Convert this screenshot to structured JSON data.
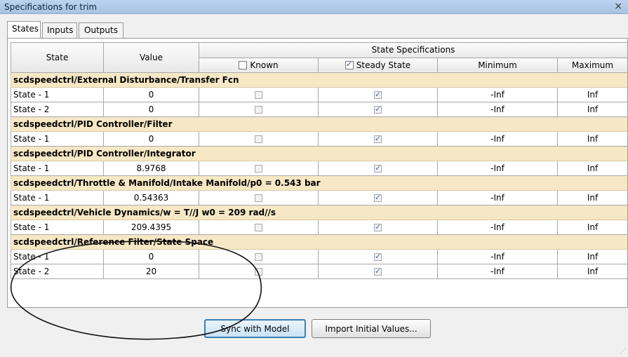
{
  "window": {
    "title": "Specifications for trim",
    "close_label": "×"
  },
  "tabs": [
    {
      "label": "States",
      "active": true
    },
    {
      "label": "Inputs",
      "active": false
    },
    {
      "label": "Outputs",
      "active": false
    }
  ],
  "table": {
    "col_state": "State",
    "col_value": "Value",
    "col_specs": "State Specifications",
    "col_known": "Known",
    "col_steady": "Steady State",
    "col_min": "Minimum",
    "col_max": "Maximum",
    "header_known_checked": false,
    "header_steady_checked": true
  },
  "groups": [
    {
      "name": "scdspeedctrl/External Disturbance/Transfer Fcn",
      "rows": [
        {
          "state": "State - 1",
          "value": "0",
          "known": false,
          "steady": true,
          "min": "-Inf",
          "max": "Inf"
        },
        {
          "state": "State - 2",
          "value": "0",
          "known": false,
          "steady": true,
          "min": "-Inf",
          "max": "Inf"
        }
      ]
    },
    {
      "name": "scdspeedctrl/PID Controller/Filter",
      "rows": [
        {
          "state": "State - 1",
          "value": "0",
          "known": false,
          "steady": true,
          "min": "-Inf",
          "max": "Inf"
        }
      ]
    },
    {
      "name": "scdspeedctrl/PID Controller/Integrator",
      "rows": [
        {
          "state": "State - 1",
          "value": "8.9768",
          "known": false,
          "steady": true,
          "min": "-Inf",
          "max": "Inf"
        }
      ]
    },
    {
      "name": "scdspeedctrl/Throttle & Manifold/Intake Manifold/p0 = 0.543 bar",
      "rows": [
        {
          "state": "State - 1",
          "value": "0.54363",
          "known": false,
          "steady": true,
          "min": "-Inf",
          "max": "Inf"
        }
      ]
    },
    {
      "name": "scdspeedctrl/Vehicle Dynamics/w = T//J w0 = 209 rad//s",
      "rows": [
        {
          "state": "State - 1",
          "value": "209.4395",
          "known": false,
          "steady": true,
          "min": "-Inf",
          "max": "Inf"
        }
      ]
    },
    {
      "name": "scdspeedctrl/Reference Filter/State Space",
      "rows": [
        {
          "state": "State - 1",
          "value": "0",
          "known": false,
          "steady": true,
          "min": "-Inf",
          "max": "Inf"
        },
        {
          "state": "State - 2",
          "value": "20",
          "known": false,
          "steady": true,
          "min": "-Inf",
          "max": "Inf"
        }
      ]
    }
  ],
  "buttons": {
    "sync": "Sync with Model",
    "import": "Import Initial Values..."
  },
  "grip": "⋰"
}
